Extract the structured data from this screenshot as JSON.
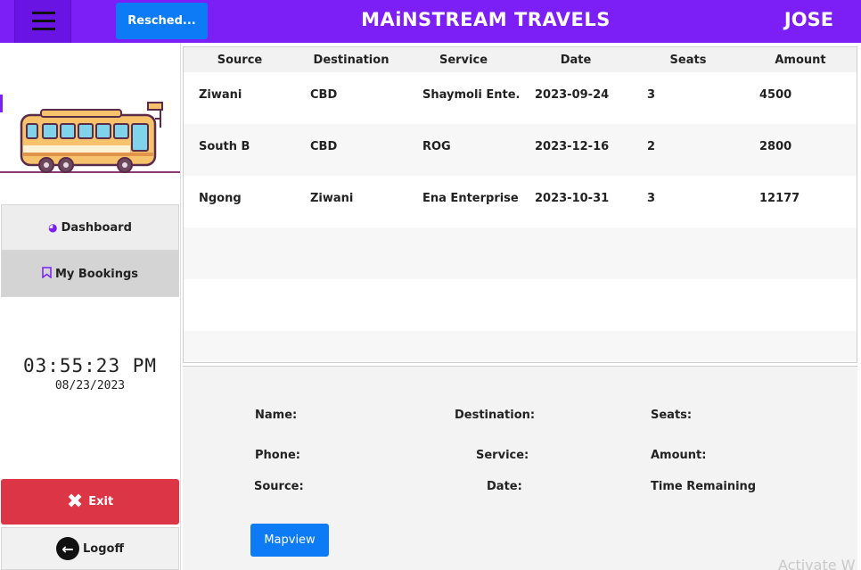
{
  "header": {
    "resched_label": "Resched...",
    "title": "MAiNSTREAM TRAVELS",
    "user": "JOSE"
  },
  "sidebar": {
    "items": [
      {
        "label": "Dashboard",
        "icon": "speedometer-icon"
      },
      {
        "label": "My Bookings",
        "icon": "bookmark-icon"
      }
    ],
    "clock_time": "03:55:23 PM",
    "clock_date": "08/23/2023",
    "exit_label": "Exit",
    "logoff_label": "Logoff"
  },
  "table": {
    "columns": [
      "Source",
      "Destination",
      "Service",
      "Date",
      "Seats",
      "Amount"
    ],
    "rows": [
      {
        "source": "Ziwani",
        "destination": "CBD",
        "service": "Shaymoli Ente...",
        "date": "2023-09-24",
        "seats": "3",
        "amount": "4500"
      },
      {
        "source": "South B",
        "destination": "CBD",
        "service": "ROG",
        "date": "2023-12-16",
        "seats": "2",
        "amount": "2800"
      },
      {
        "source": "Ngong",
        "destination": "Ziwani",
        "service": "Ena Enterprise",
        "date": "2023-10-31",
        "seats": "3",
        "amount": "12177"
      }
    ]
  },
  "details": {
    "name_label": "Name:",
    "destination_label": "Destination:",
    "seats_label": "Seats:",
    "phone_label": "Phone:",
    "service_label": "Service:",
    "amount_label": "Amount:",
    "source_label": "Source:",
    "date_label": "Date:",
    "time_remaining_label": "Time Remaining",
    "mapview_label": "Mapview"
  },
  "watermark": "Activate W",
  "colors": {
    "header": "#7b1ff6",
    "primary_button": "#0d7bf6",
    "exit_button": "#dc3545"
  }
}
